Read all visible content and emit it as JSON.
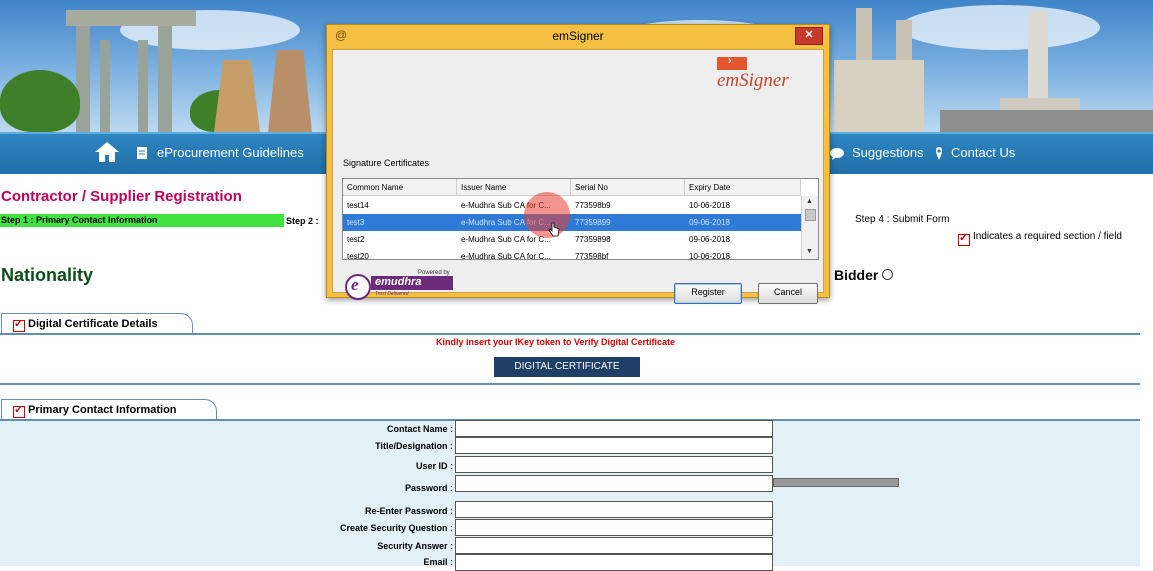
{
  "nav": {
    "guidelines": "eProcurement Guidelines",
    "suggestions": "Suggestions",
    "contact": "Contact Us"
  },
  "registration": {
    "title": "Contractor / Supplier Registration",
    "step1": "Step 1 : Primary Contact Information",
    "step2": "Step 2 :",
    "step4": "Step 4 : Submit Form",
    "required_note": "Indicates a required section / field",
    "nationality": "Nationality",
    "bidder": "Bidder"
  },
  "digital_cert": {
    "tab": "Digital Certificate Details",
    "notice": "Kindly insert your IKey token to Verify Digital Certificate",
    "button": "DIGITAL CERTIFICATE",
    "notice_color": "#d40000"
  },
  "primary_contact": {
    "tab": "Primary Contact Information",
    "fields": [
      "Contact Name :",
      "Title/Designation :",
      "User ID :",
      "Password :",
      "Re-Enter Password :",
      "Create Security Question  :",
      "Security Answer  :",
      "Email :"
    ]
  },
  "dialog": {
    "title": "emSigner",
    "close": "✕",
    "window_icon": "@",
    "logo_text": "emSigner",
    "section_label": "Signature Certificates",
    "columns": [
      "Common Name",
      "Issuer Name",
      "Serial No",
      "Expiry Date"
    ],
    "rows": [
      [
        "test14",
        "e-Mudhra Sub CA for C...",
        "773598b9",
        "10-06-2018"
      ],
      [
        "test3",
        "e-Mudhra Sub CA for C...",
        "77359899",
        "09-06-2018"
      ],
      [
        "test2",
        "e-Mudhra Sub CA for C...",
        "77359898",
        "09-06-2018"
      ],
      [
        "test20",
        "e-Mudhra Sub CA for C...",
        "773598bf",
        "10-06-2018"
      ]
    ],
    "selected_row": 1,
    "powered_by": "Powered by",
    "brand": "emudhra",
    "brand_tagline": "Trust Delivered",
    "register_label": "Register",
    "cancel_label": "Cancel",
    "selection_color": "#2f7ad6"
  }
}
